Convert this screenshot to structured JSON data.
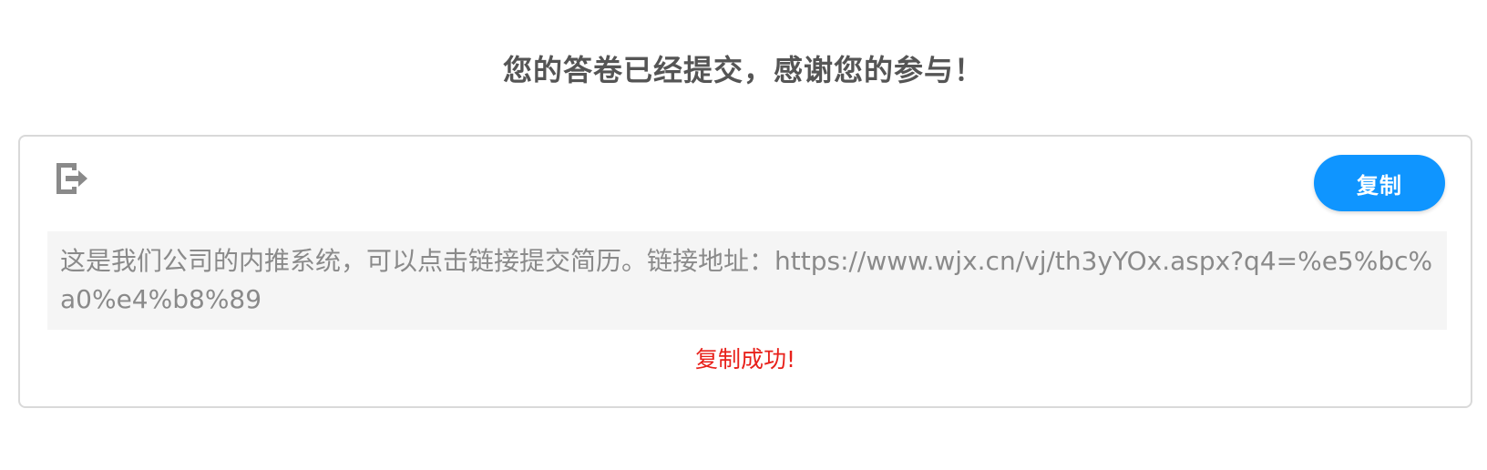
{
  "header": {
    "title": "您的答卷已经提交，感谢您的参与！"
  },
  "share_card": {
    "icon": "share-export-icon",
    "copy_label": "复制",
    "link_text": "这是我们公司的内推系统，可以点击链接提交简历。链接地址：https://www.wjx.cn/vj/th3yYOx.aspx?q4=%e5%bc%a0%e4%b8%89",
    "success_message": "复制成功!"
  },
  "colors": {
    "accent": "#0f95ff",
    "success_text": "#e8211b",
    "link_box_bg": "#f5f5f5"
  }
}
